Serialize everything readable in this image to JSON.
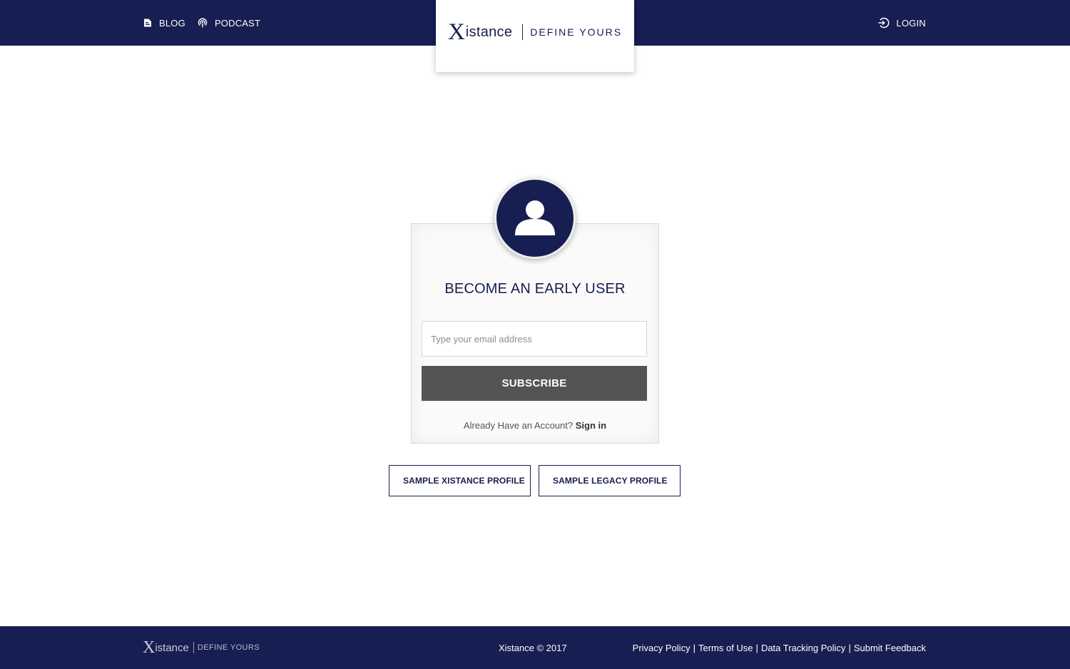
{
  "header": {
    "nav_left": [
      {
        "label": "BLOG",
        "icon": "blog-icon"
      },
      {
        "label": "PODCAST",
        "icon": "podcast-icon"
      }
    ],
    "login_label": "LOGIN",
    "login_icon": "login-icon"
  },
  "logo": {
    "mark": "X",
    "word": "istance",
    "tagline": "DEFINE YOURS"
  },
  "signup": {
    "avatar_icon": "user-icon",
    "title": "BECOME AN EARLY USER",
    "email_placeholder": "Type your email address",
    "email_value": "",
    "subscribe_label": "SUBSCRIBE",
    "account_prompt": "Already Have an Account?",
    "signin_label": "Sign in"
  },
  "samples": [
    {
      "label": "SAMPLE XISTANCE PROFILE"
    },
    {
      "label": "SAMPLE LEGACY PROFILE"
    }
  ],
  "footer": {
    "logo": {
      "mark": "X",
      "word": "istance",
      "tagline": "DEFINE YOURS"
    },
    "copyright": "Xistance © 2017",
    "links": [
      "Privacy Policy",
      "Terms of Use",
      "Data Tracking Policy",
      "Submit Feedback"
    ],
    "separator": "|"
  },
  "colors": {
    "brand_navy": "#161e52",
    "subscribe_gray": "#545454",
    "background": "#ffffff"
  }
}
